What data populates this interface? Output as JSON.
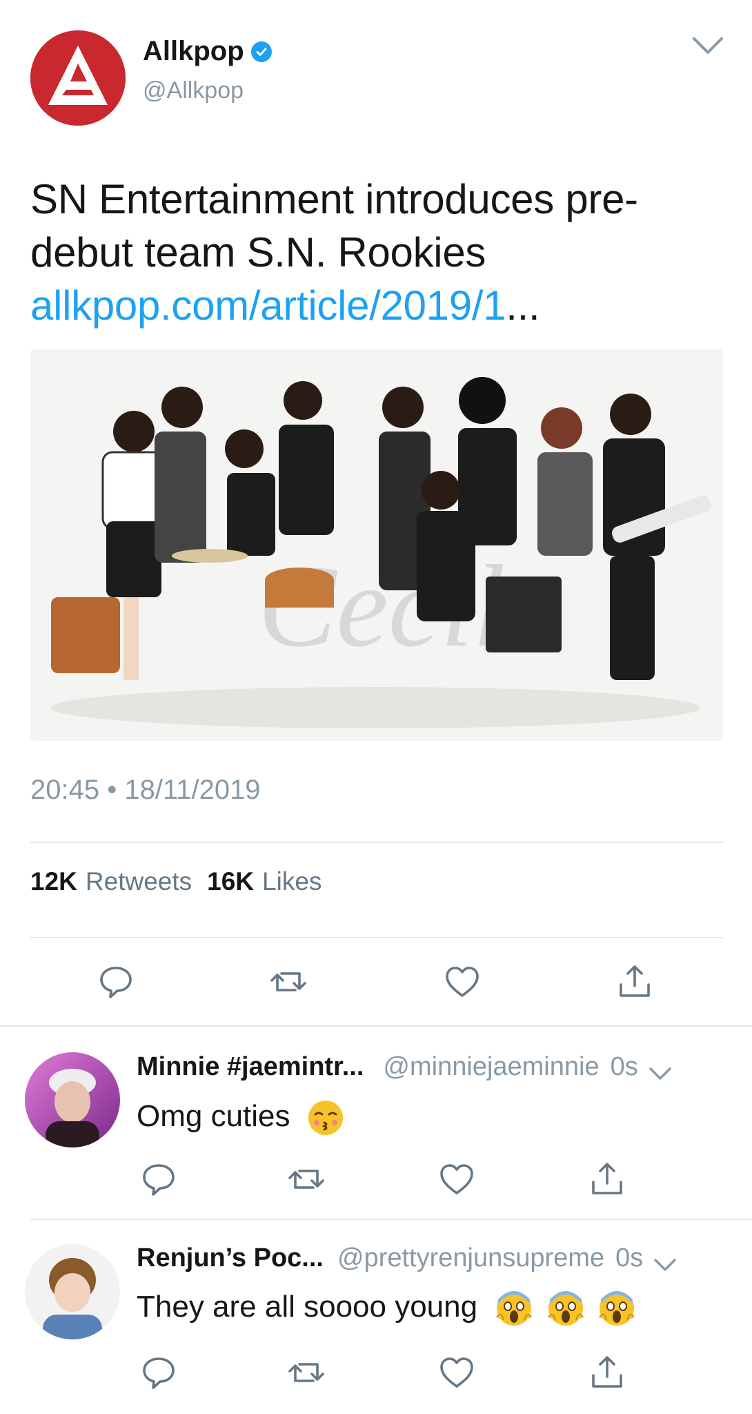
{
  "tweet": {
    "display_name": "Allkpop",
    "handle": "@Allkpop",
    "text_line1": "SN Entertainment introduces pre-",
    "text_line2": "debut team S.N. Rookies",
    "link_text": "allkpop.com/article/2019/1",
    "link_ellipsis": "...",
    "timestamp": "20:45 • 18/11/2019",
    "retweets_count": "12K",
    "retweets_label": "Retweets",
    "likes_count": "16K",
    "likes_label": "Likes",
    "media_watermark": "Cecil"
  },
  "replies": [
    {
      "display_name": "Minnie #jaemintr...",
      "handle": "@minniejaeminnie",
      "time": "0s",
      "text": "Omg cuties",
      "emoji": "kissing-face-closed-eyes"
    },
    {
      "display_name": "Renjun’s Poc...",
      "handle": "@prettyrenjunsupreme",
      "time": "0s",
      "text": "They are all soooo young",
      "emoji": "face-screaming-in-fear x3"
    }
  ],
  "colors": {
    "accent": "#1da1f2",
    "brand_red": "#c8282e",
    "muted": "#8899a6",
    "divider": "#e1e8ed"
  }
}
